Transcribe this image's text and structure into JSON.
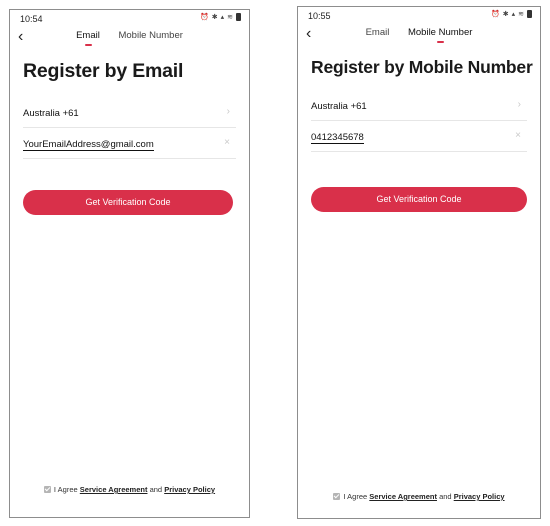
{
  "screens": [
    {
      "status_time": "10:54",
      "tabs": [
        {
          "label": "Email"
        },
        {
          "label": "Mobile Number"
        }
      ],
      "active_tab": 0,
      "title": "Register by Email",
      "region": "Australia +61",
      "input_value": "YourEmailAddress@gmail.com",
      "button_label": "Get Verification Code",
      "agree": {
        "prefix": "I Agree",
        "service": "Service Agreement",
        "and": "and",
        "privacy": "Privacy Policy"
      }
    },
    {
      "status_time": "10:55",
      "tabs": [
        {
          "label": "Email"
        },
        {
          "label": "Mobile Number"
        }
      ],
      "active_tab": 1,
      "title": "Register by Mobile Number",
      "region": "Australia +61",
      "input_value": "0412345678",
      "button_label": "Get Verification Code",
      "agree": {
        "prefix": "I Agree",
        "service": "Service Agreement",
        "and": "and",
        "privacy": "Privacy Policy"
      }
    }
  ],
  "icons": {
    "back": "chevron-left-icon",
    "region_arrow": "chevron-right-icon",
    "clear": "close-icon",
    "checkbox": "checkbox-checked-icon"
  },
  "colors": {
    "accent": "#d9304a"
  }
}
